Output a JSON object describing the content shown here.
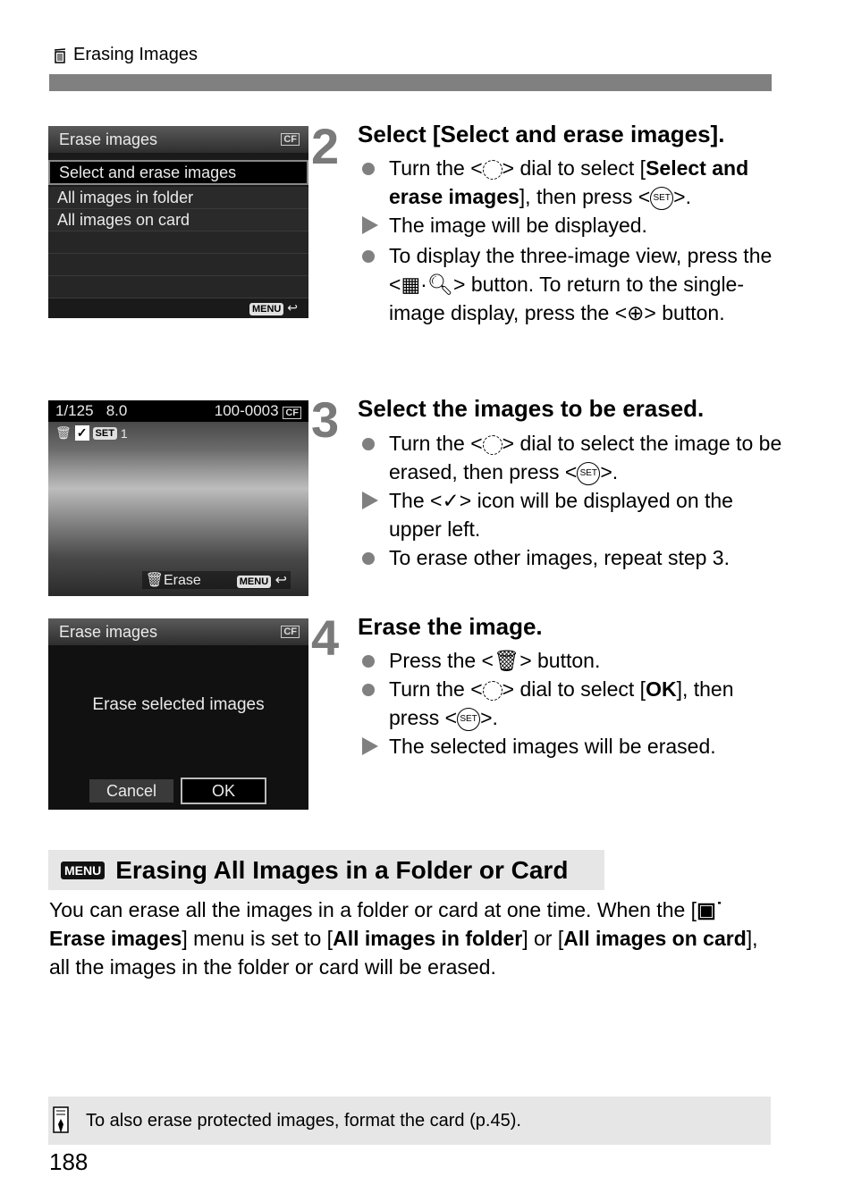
{
  "header": {
    "icon": "trash-icon",
    "title": "Erasing Images"
  },
  "steps": [
    {
      "number": "2",
      "title": "Select [Select and erase images].",
      "screen": {
        "title": "Erase images",
        "card": "CF",
        "items": [
          "Select and erase images",
          "All images in folder",
          "All images on card"
        ],
        "selected": "Select and erase images",
        "footer_button": "MENU",
        "footer_icon": "return-icon"
      },
      "bullets": [
        {
          "type": "dot",
          "parts": [
            "Turn the <",
            "dial-icon",
            "> dial to select [",
            "**Select and erase images**",
            "], then press <",
            "set-icon",
            ">."
          ]
        },
        {
          "type": "arrow",
          "text": "The image will be displayed."
        },
        {
          "type": "dot",
          "parts": [
            "To display the three-image view, press the <",
            "index-zoom-out-icon",
            "> button. To return to the single-image display, press the <",
            "zoom-in-icon",
            "> button."
          ]
        }
      ]
    },
    {
      "number": "3",
      "title": "Select the images to be erased.",
      "screen": {
        "shutter": "1/125",
        "aperture": "8.0",
        "file": "100-0003",
        "card": "CF",
        "overlay": [
          "✓",
          "SET",
          "1"
        ],
        "erase_label": "Erase",
        "footer_button": "MENU"
      },
      "bullets": [
        {
          "type": "dot",
          "parts": [
            "Turn the <",
            "dial-icon",
            "> dial to select the image to be erased, then press <",
            "set-icon",
            ">."
          ]
        },
        {
          "type": "arrow",
          "parts": [
            "The <",
            "check-icon",
            "> icon will be displayed on the upper left."
          ]
        },
        {
          "type": "dot",
          "text": "To erase other images, repeat step 3."
        }
      ]
    },
    {
      "number": "4",
      "title": "Erase the image.",
      "screen": {
        "title": "Erase images",
        "card": "CF",
        "message": "Erase selected images",
        "cancel": "Cancel",
        "ok": "OK"
      },
      "bullets": [
        {
          "type": "dot",
          "parts": [
            "Press the <",
            "trash-icon",
            "> button."
          ]
        },
        {
          "type": "dot",
          "parts": [
            "Turn the <",
            "dial-icon",
            "> dial to select [",
            "**OK**",
            "], then press <",
            "set-icon",
            ">."
          ]
        },
        {
          "type": "arrow",
          "text": "The selected images will be erased."
        }
      ]
    }
  ],
  "section": {
    "badge": "MENU",
    "title": "Erasing All Images in a Folder or Card",
    "paragraph": {
      "t1": "You can erase all the images in a folder or card at one time. When the [",
      "b1": " Erase images",
      "t2": "] menu is set to [",
      "b2": "All images in folder",
      "t3": "] or [",
      "b3": "All images on card",
      "t4": "], all the images in the folder or card will be erased."
    }
  },
  "note": {
    "icon": "memo-icon",
    "text": "To also erase protected images, format the card (p.45)."
  },
  "page_number": "188",
  "colors": {
    "gray_bar": "#808080",
    "bullet": "#808080",
    "section_bg": "#e6e6e6"
  }
}
